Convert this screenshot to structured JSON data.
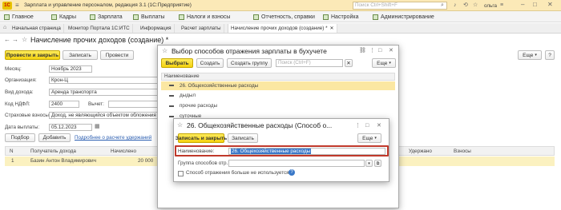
{
  "titlebar": {
    "app_title": "Зарплата и управление персоналом, редакция 3.1  (1С:Предприятие)",
    "search_placeholder": "Поиск Ctrl+Shift+F",
    "user": "ольга"
  },
  "menu": {
    "items": [
      {
        "label": "Главное"
      },
      {
        "label": "Кадры"
      },
      {
        "label": "Зарплата"
      },
      {
        "label": "Выплаты"
      },
      {
        "label": "Налоги и взносы"
      },
      {
        "label": "Отчетность, справки"
      },
      {
        "label": "Настройка"
      },
      {
        "label": "Администрирование"
      }
    ]
  },
  "tabs": [
    {
      "label": "Начальная страница"
    },
    {
      "label": "Монитор Портала 1С:ИТС"
    },
    {
      "label": "Информация"
    },
    {
      "label": "Расчет зарплаты"
    },
    {
      "label": "Начисление прочих доходов (создание) *"
    }
  ],
  "doc": {
    "title": "Начисление прочих доходов (создание) *",
    "btn_post_close": "Провести и закрыть",
    "btn_save": "Записать",
    "btn_post": "Провести",
    "btn_more": "Еще",
    "lbl_month": "Месяц:",
    "val_month": "Ноябрь 2023",
    "lbl_org": "Организация:",
    "val_org": "Крон-Ц",
    "lbl_income_type": "Вид дохода:",
    "val_income_type": "Аренда транспорта",
    "lbl_ndfl_code": "Код НДФЛ:",
    "val_ndfl_code": "2400",
    "lbl_deduction": "Вычет:",
    "lbl_insurance": "Страховые взносы:",
    "val_insurance": "Доход, не являющийся объектом обложения",
    "lbl_pay_date": "Дата выплаты:",
    "val_pay_date": "05.12.2023",
    "btn_select": "Подбор",
    "btn_add": "Добавить",
    "link_details": "Подробнее о расчете удержаний",
    "table_headers": [
      "N",
      "Получатель дохода",
      "Начислено",
      "Удержано",
      "Взносы"
    ],
    "rows": [
      {
        "n": "1",
        "recipient": "Базин Антон Владимирович",
        "accrued": "20 000"
      }
    ]
  },
  "modal1": {
    "title": "Выбор способов отражения зарплаты в бухучете",
    "btn_choose": "Выбрать",
    "btn_create": "Создать",
    "btn_create_group": "Создать группу",
    "search_placeholder": "Поиск (Ctrl+F)",
    "btn_more": "Еще",
    "col_header": "Наименование",
    "items": [
      {
        "label": "26. Общехозяйственные расходы"
      },
      {
        "label": "дыдыл"
      },
      {
        "label": "прочие расходы"
      },
      {
        "label": "суточные"
      }
    ]
  },
  "modal2": {
    "title": "26. Общехозяйственные расходы (Способ о...",
    "btn_save_close": "Записать и закрыть",
    "btn_save": "Записать",
    "btn_more": "Еще",
    "lbl_name": "Наименование:",
    "val_name": "26. Общехозяйственные расходы",
    "lbl_group": "Группа способов отр.:",
    "chk_label": "Способ отражения больше не используется"
  },
  "colors": {
    "accent_yellow": "#f5d20f",
    "highlight_red": "#c0392b",
    "selection_blue": "#3a78c8"
  }
}
